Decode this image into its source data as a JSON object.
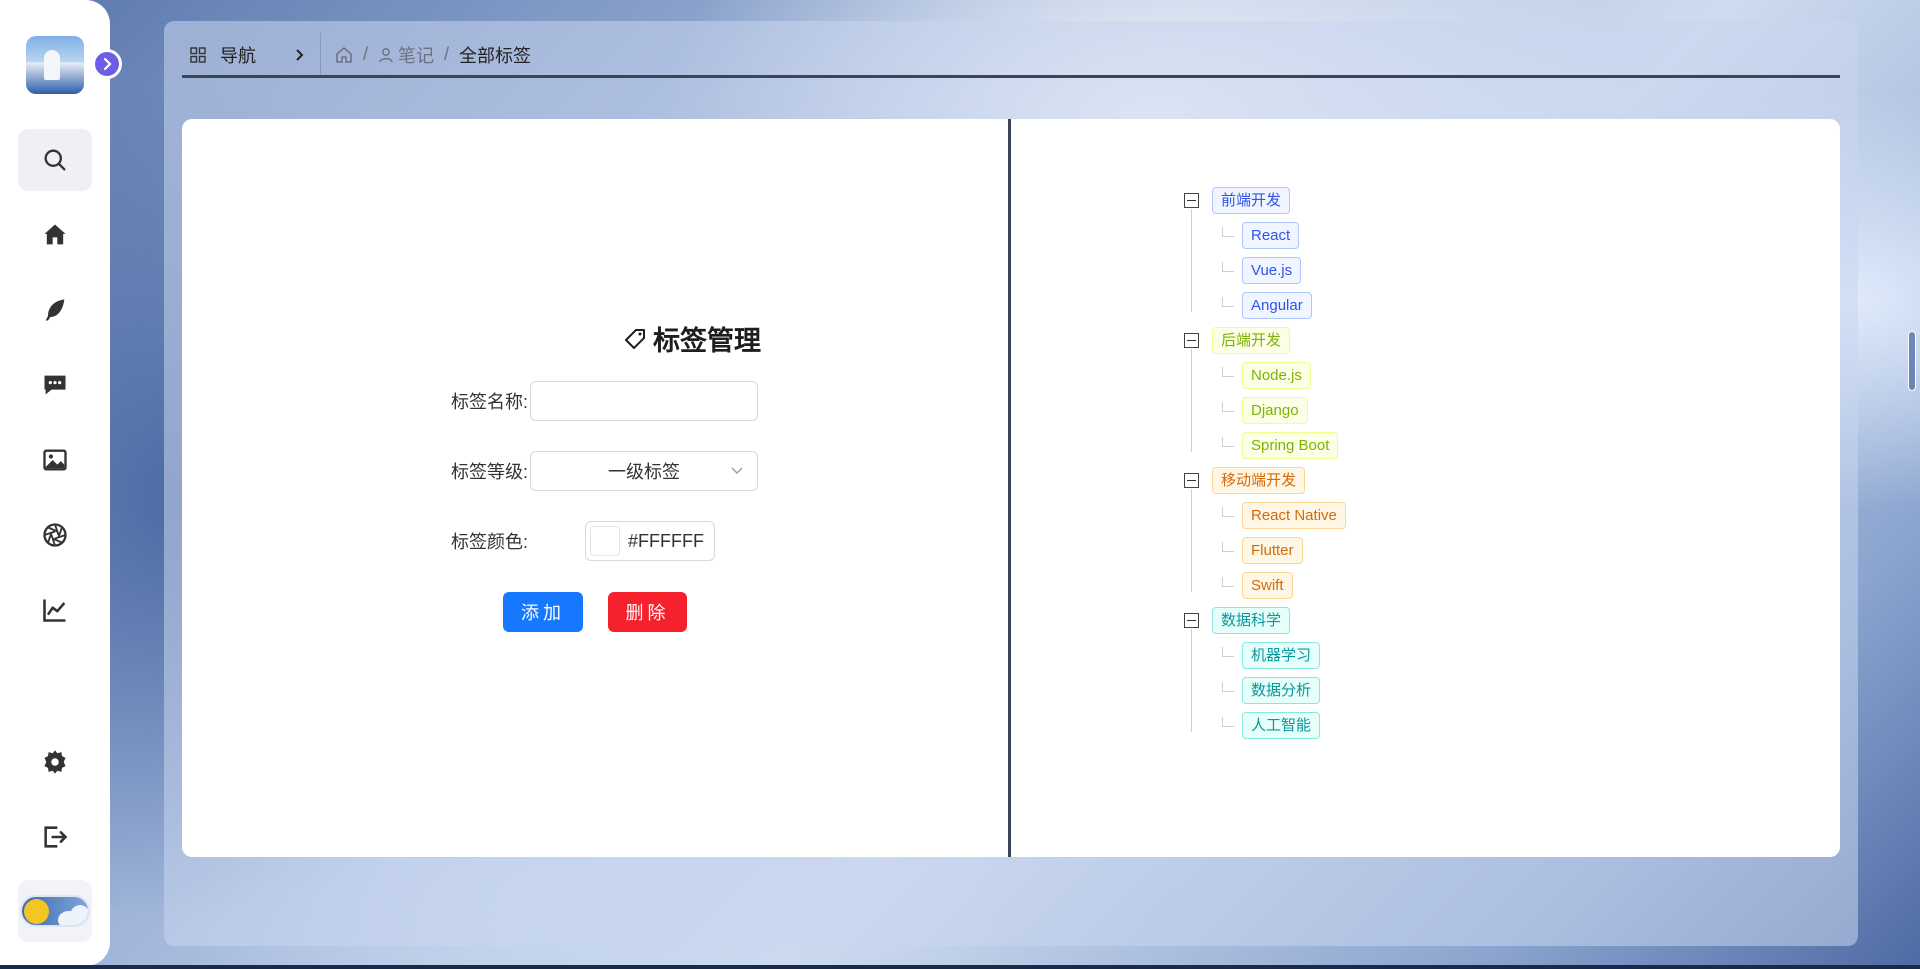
{
  "nav": {
    "label": "导航"
  },
  "breadcrumb": {
    "level1": "笔记",
    "current": "全部标签",
    "separator": "/"
  },
  "form": {
    "title": "标签管理",
    "name_label": "标签名称:",
    "name_value": "",
    "level_label": "标签等级:",
    "level_value": "一级标签",
    "color_label": "标签颜色:",
    "color_value": "#FFFFFF",
    "add_button": "添加",
    "delete_button": "删除"
  },
  "tree": [
    {
      "label": "前端开发",
      "color": "blue",
      "children": [
        "React",
        "Vue.js",
        "Angular"
      ]
    },
    {
      "label": "后端开发",
      "color": "lime",
      "children": [
        "Node.js",
        "Django",
        "Spring Boot"
      ]
    },
    {
      "label": "移动端开发",
      "color": "orange",
      "children": [
        "React Native",
        "Flutter",
        "Swift"
      ]
    },
    {
      "label": "数据科学",
      "color": "cyan",
      "children": [
        "机器学习",
        "数据分析",
        "人工智能"
      ]
    }
  ],
  "sidebar": {
    "items": [
      "search-icon",
      "home-icon",
      "feather-icon",
      "chat-icon",
      "image-icon",
      "aperture-icon",
      "chart-icon",
      "settings-icon",
      "logout-icon"
    ]
  },
  "theme": {
    "accent": "#6d5ce8",
    "primary": "#1677ff",
    "danger": "#f5222d"
  }
}
